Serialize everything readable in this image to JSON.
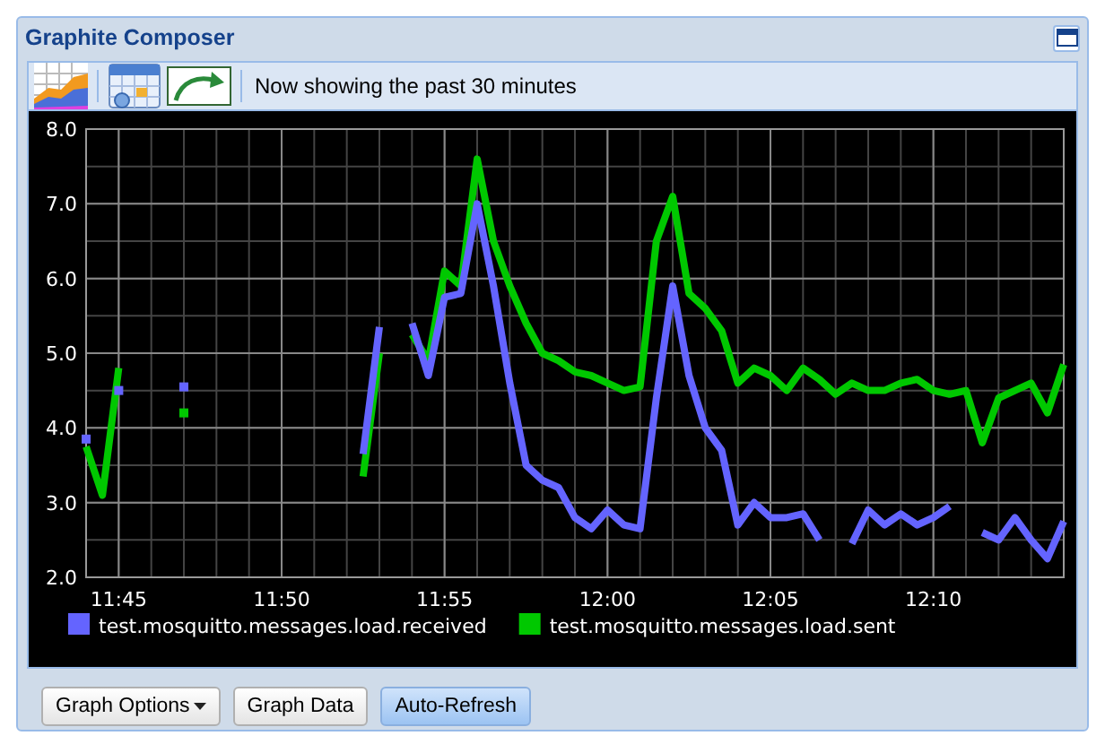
{
  "panel": {
    "title": "Graphite Composer"
  },
  "toolbar": {
    "status": "Now showing the past 30 minutes"
  },
  "graph": {
    "chart_data": {
      "type": "line",
      "ylim": [
        2,
        8
      ],
      "grid": true,
      "legend": "bottom",
      "yticks": [
        {
          "value": 2,
          "label": "2.0"
        },
        {
          "value": 3,
          "label": "3.0"
        },
        {
          "value": 4,
          "label": "4.0"
        },
        {
          "value": 5,
          "label": "5.0"
        },
        {
          "value": 6,
          "label": "6.0"
        },
        {
          "value": 7,
          "label": "7.0"
        },
        {
          "value": 8,
          "label": "8.0"
        }
      ],
      "categories": [
        null,
        null,
        "11:45",
        null,
        null,
        null,
        null,
        null,
        null,
        null,
        null,
        null,
        "11:50",
        null,
        null,
        null,
        null,
        null,
        null,
        null,
        null,
        null,
        "11:55",
        null,
        null,
        null,
        null,
        null,
        null,
        null,
        null,
        null,
        "12:00",
        null,
        null,
        null,
        null,
        null,
        null,
        null,
        null,
        null,
        "12:05",
        null,
        null,
        null,
        null,
        null,
        null,
        null,
        null,
        null,
        "12:10",
        null,
        null,
        null,
        null,
        null,
        null,
        null,
        null
      ],
      "series": [
        {
          "name": "test.mosquitto.messages.load.received",
          "color": "#6464ff",
          "values": [
            3.85,
            null,
            4.5,
            null,
            null,
            null,
            4.55,
            null,
            null,
            null,
            null,
            null,
            null,
            null,
            null,
            null,
            null,
            3.65,
            5.35,
            null,
            5.4,
            4.7,
            5.75,
            5.8,
            7.0,
            5.9,
            4.6,
            3.5,
            3.3,
            3.2,
            2.8,
            2.65,
            2.9,
            2.7,
            2.65,
            4.4,
            5.9,
            4.7,
            4.0,
            3.7,
            2.7,
            3.0,
            2.8,
            2.8,
            2.85,
            2.5,
            null,
            2.45,
            2.9,
            2.7,
            2.85,
            2.7,
            2.8,
            2.95,
            null,
            2.6,
            2.5,
            2.8,
            2.5,
            2.25,
            2.75
          ]
        },
        {
          "name": "test.mosquitto.messages.load.sent",
          "color": "#00c800",
          "values": [
            3.75,
            3.1,
            4.8,
            null,
            null,
            null,
            4.2,
            null,
            null,
            null,
            null,
            null,
            null,
            null,
            null,
            null,
            null,
            3.35,
            5.0,
            null,
            5.25,
            4.9,
            6.1,
            5.9,
            7.6,
            6.5,
            5.9,
            5.4,
            5.0,
            4.9,
            4.75,
            4.7,
            4.6,
            4.5,
            4.55,
            6.5,
            7.1,
            5.8,
            5.6,
            5.3,
            4.6,
            4.8,
            4.7,
            4.5,
            4.8,
            4.65,
            4.45,
            4.6,
            4.5,
            4.5,
            4.6,
            4.65,
            4.5,
            4.45,
            4.5,
            3.8,
            4.4,
            4.5,
            4.6,
            4.2,
            4.85
          ]
        }
      ]
    }
  },
  "buttons": [
    {
      "label": "Graph Options",
      "kind": "menu",
      "pressed": false
    },
    {
      "label": "Graph Data",
      "kind": "plain",
      "pressed": false
    },
    {
      "label": "Auto-Refresh",
      "kind": "plain",
      "pressed": true
    }
  ]
}
